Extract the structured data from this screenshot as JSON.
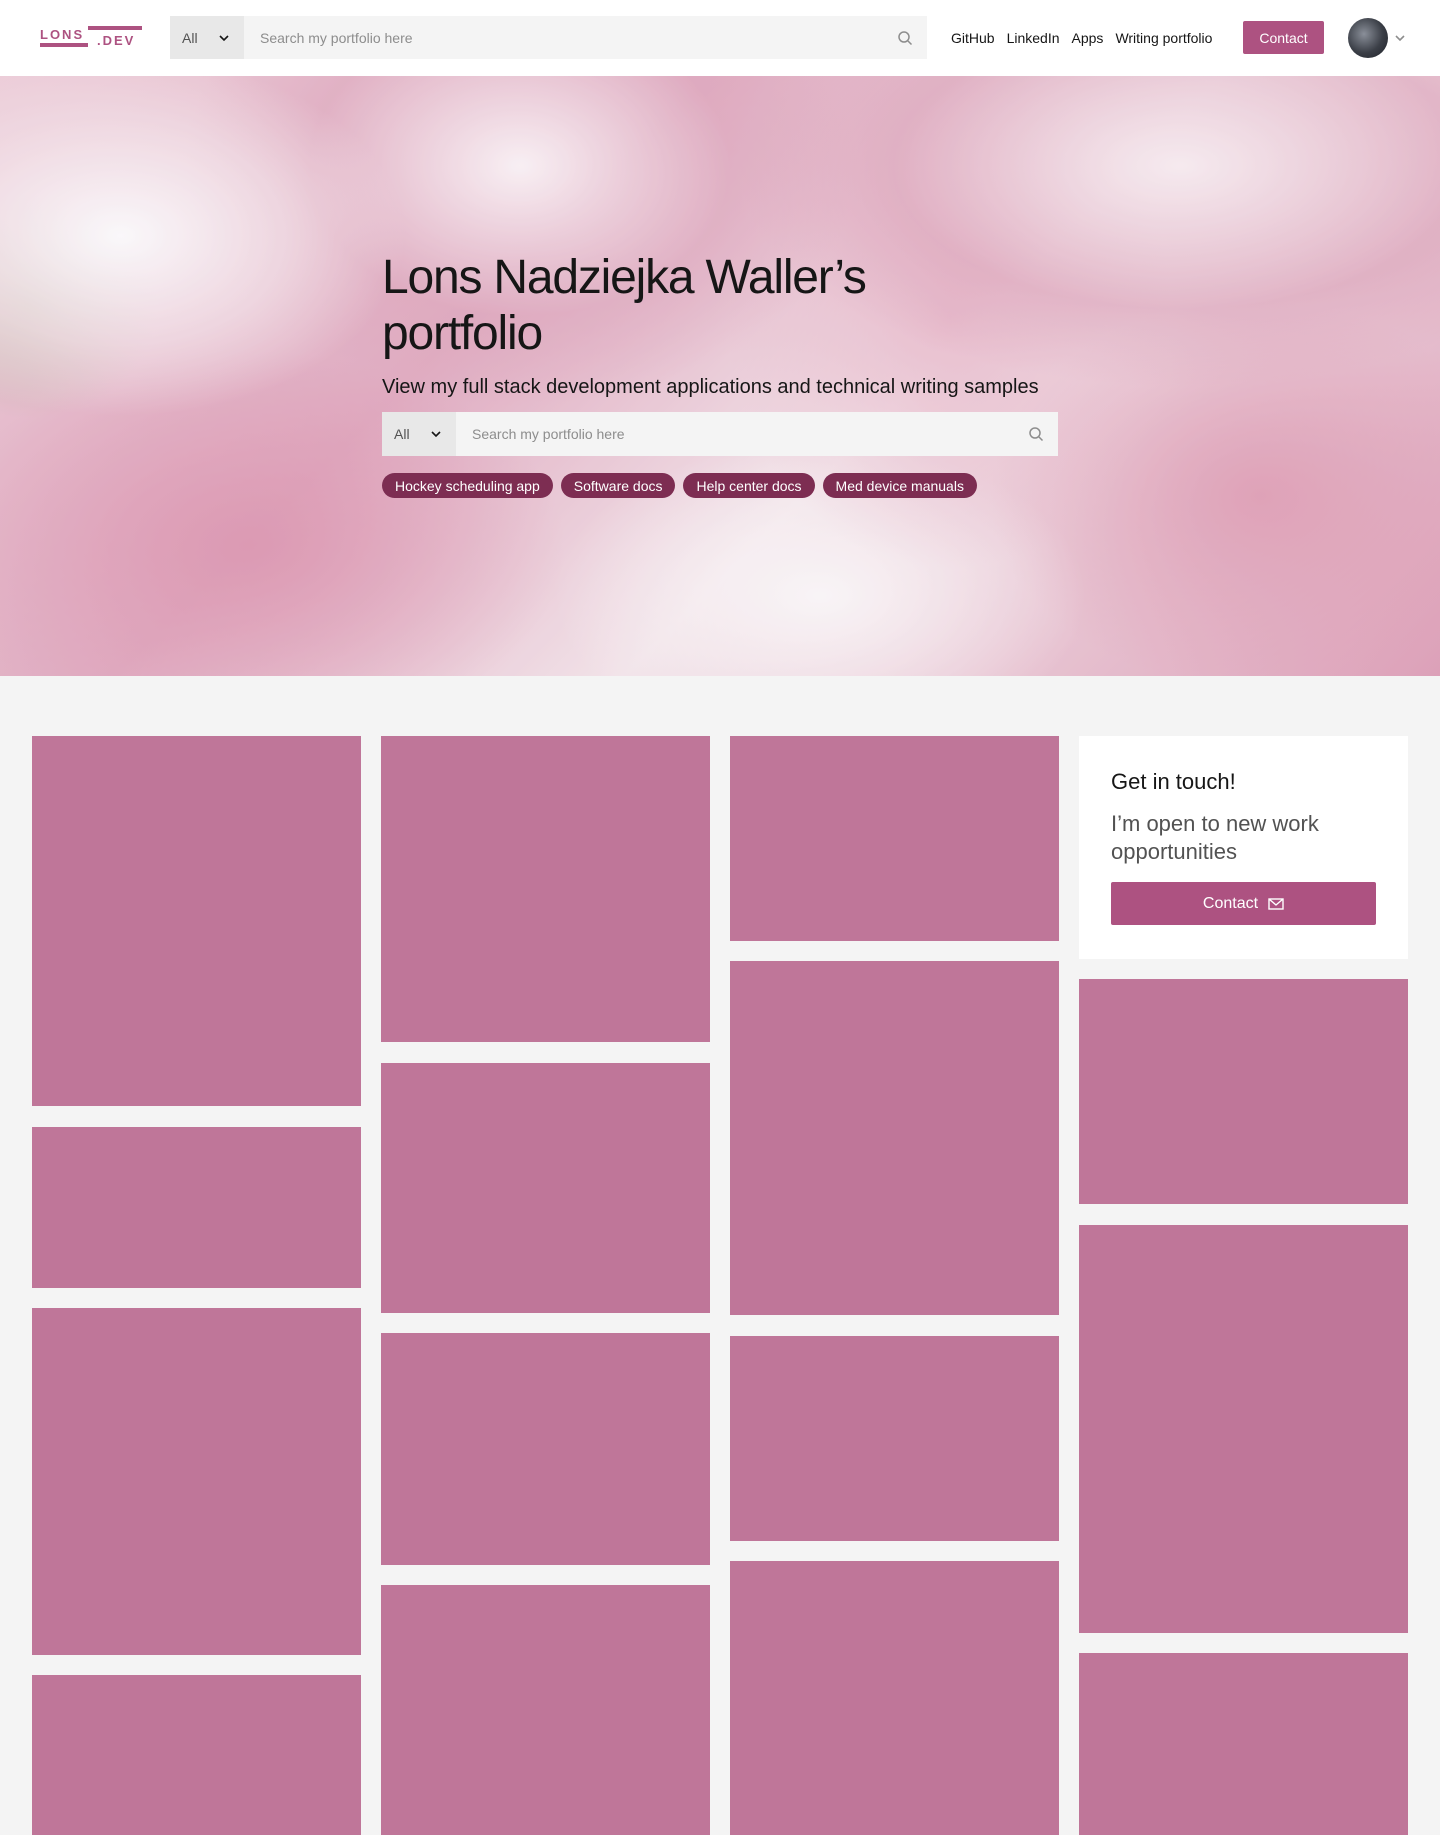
{
  "header": {
    "logo_text": "LONS.DEV",
    "search": {
      "scope": "All",
      "placeholder": "Search my portfolio here"
    },
    "nav": [
      "GitHub",
      "LinkedIn",
      "Apps",
      "Writing portfolio"
    ],
    "contact_label": "Contact"
  },
  "hero": {
    "title": "Lons Nadziejka Waller’s portfolio",
    "subtitle": "View my full stack development applications and technical writing samples",
    "search": {
      "scope": "All",
      "placeholder": "Search my portfolio here"
    },
    "tags": [
      "Hockey scheduling app",
      "Software docs",
      "Help center docs",
      "Med device manuals"
    ]
  },
  "touch_card": {
    "title": "Get in touch!",
    "text": "I’m open to new work opportunities",
    "button_label": "Contact"
  },
  "colors": {
    "accent": "#ad5281",
    "tile": "#bf7699",
    "tag": "#7d2d52",
    "page_bg": "#f4f4f4"
  },
  "icons": [
    "search-icon",
    "chevron-down-icon",
    "avatar",
    "mail-icon"
  ]
}
